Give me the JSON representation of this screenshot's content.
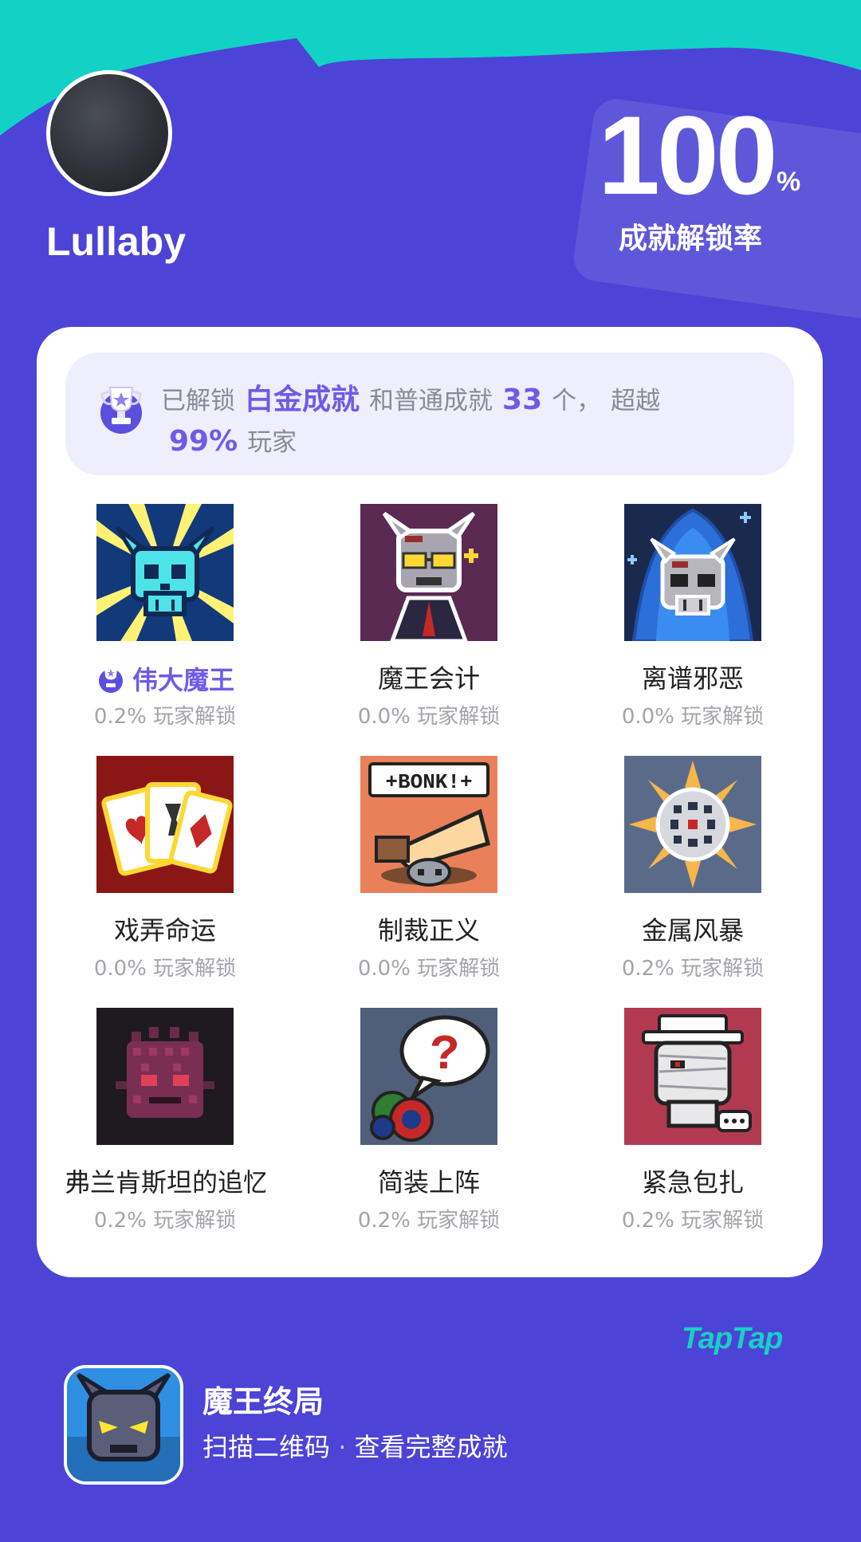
{
  "colors": {
    "background": "#4c44d6",
    "wave": "#12d2c6",
    "accent": "#6c5ce7",
    "card": "#ffffff",
    "summary_bg": "#efeefc",
    "taptap": "#18d0c4"
  },
  "profile": {
    "username": "Lullaby",
    "avatar_icon": "user-avatar"
  },
  "unlock_rate": {
    "value": "100",
    "unit": "%",
    "label": "成就解锁率"
  },
  "summary": {
    "icon": "platinum-trophy-icon",
    "prefix": "已解锁",
    "platinum_label": "白金成就",
    "middle": "和普通成就",
    "count": "33",
    "count_suffix": "个，",
    "exceed_label": "超越",
    "percent": "99%",
    "suffix": "玩家"
  },
  "achievements": [
    {
      "name": "伟大魔王",
      "stat": "0.2% 玩家解锁",
      "platinum": true,
      "icon": "cyan-skull-icon"
    },
    {
      "name": "魔王会计",
      "stat": "0.0% 玩家解锁",
      "platinum": false,
      "icon": "accountant-demon-icon"
    },
    {
      "name": "离谱邪恶",
      "stat": "0.0% 玩家解锁",
      "platinum": false,
      "icon": "hooded-skull-icon"
    },
    {
      "name": "戏弄命运",
      "stat": "0.0% 玩家解锁",
      "platinum": false,
      "icon": "playing-cards-icon"
    },
    {
      "name": "制裁正义",
      "stat": "0.0% 玩家解锁",
      "platinum": false,
      "icon": "bonk-icon"
    },
    {
      "name": "金属风暴",
      "stat": "0.2% 玩家解锁",
      "platinum": false,
      "icon": "metal-storm-icon"
    },
    {
      "name": "弗兰肯斯坦的追忆",
      "stat": "0.2% 玩家解锁",
      "platinum": false,
      "icon": "frankenstein-icon"
    },
    {
      "name": "简装上阵",
      "stat": "0.2% 玩家解锁",
      "platinum": false,
      "icon": "question-bubble-icon"
    },
    {
      "name": "紧急包扎",
      "stat": "0.2% 玩家解锁",
      "platinum": false,
      "icon": "mummy-icon"
    }
  ],
  "branding": {
    "logo_text": "TapTap"
  },
  "game": {
    "icon": "demon-king-icon",
    "title": "魔王终局",
    "subtitle_left": "扫描二维码",
    "separator": "·",
    "subtitle_right": "查看完整成就"
  }
}
